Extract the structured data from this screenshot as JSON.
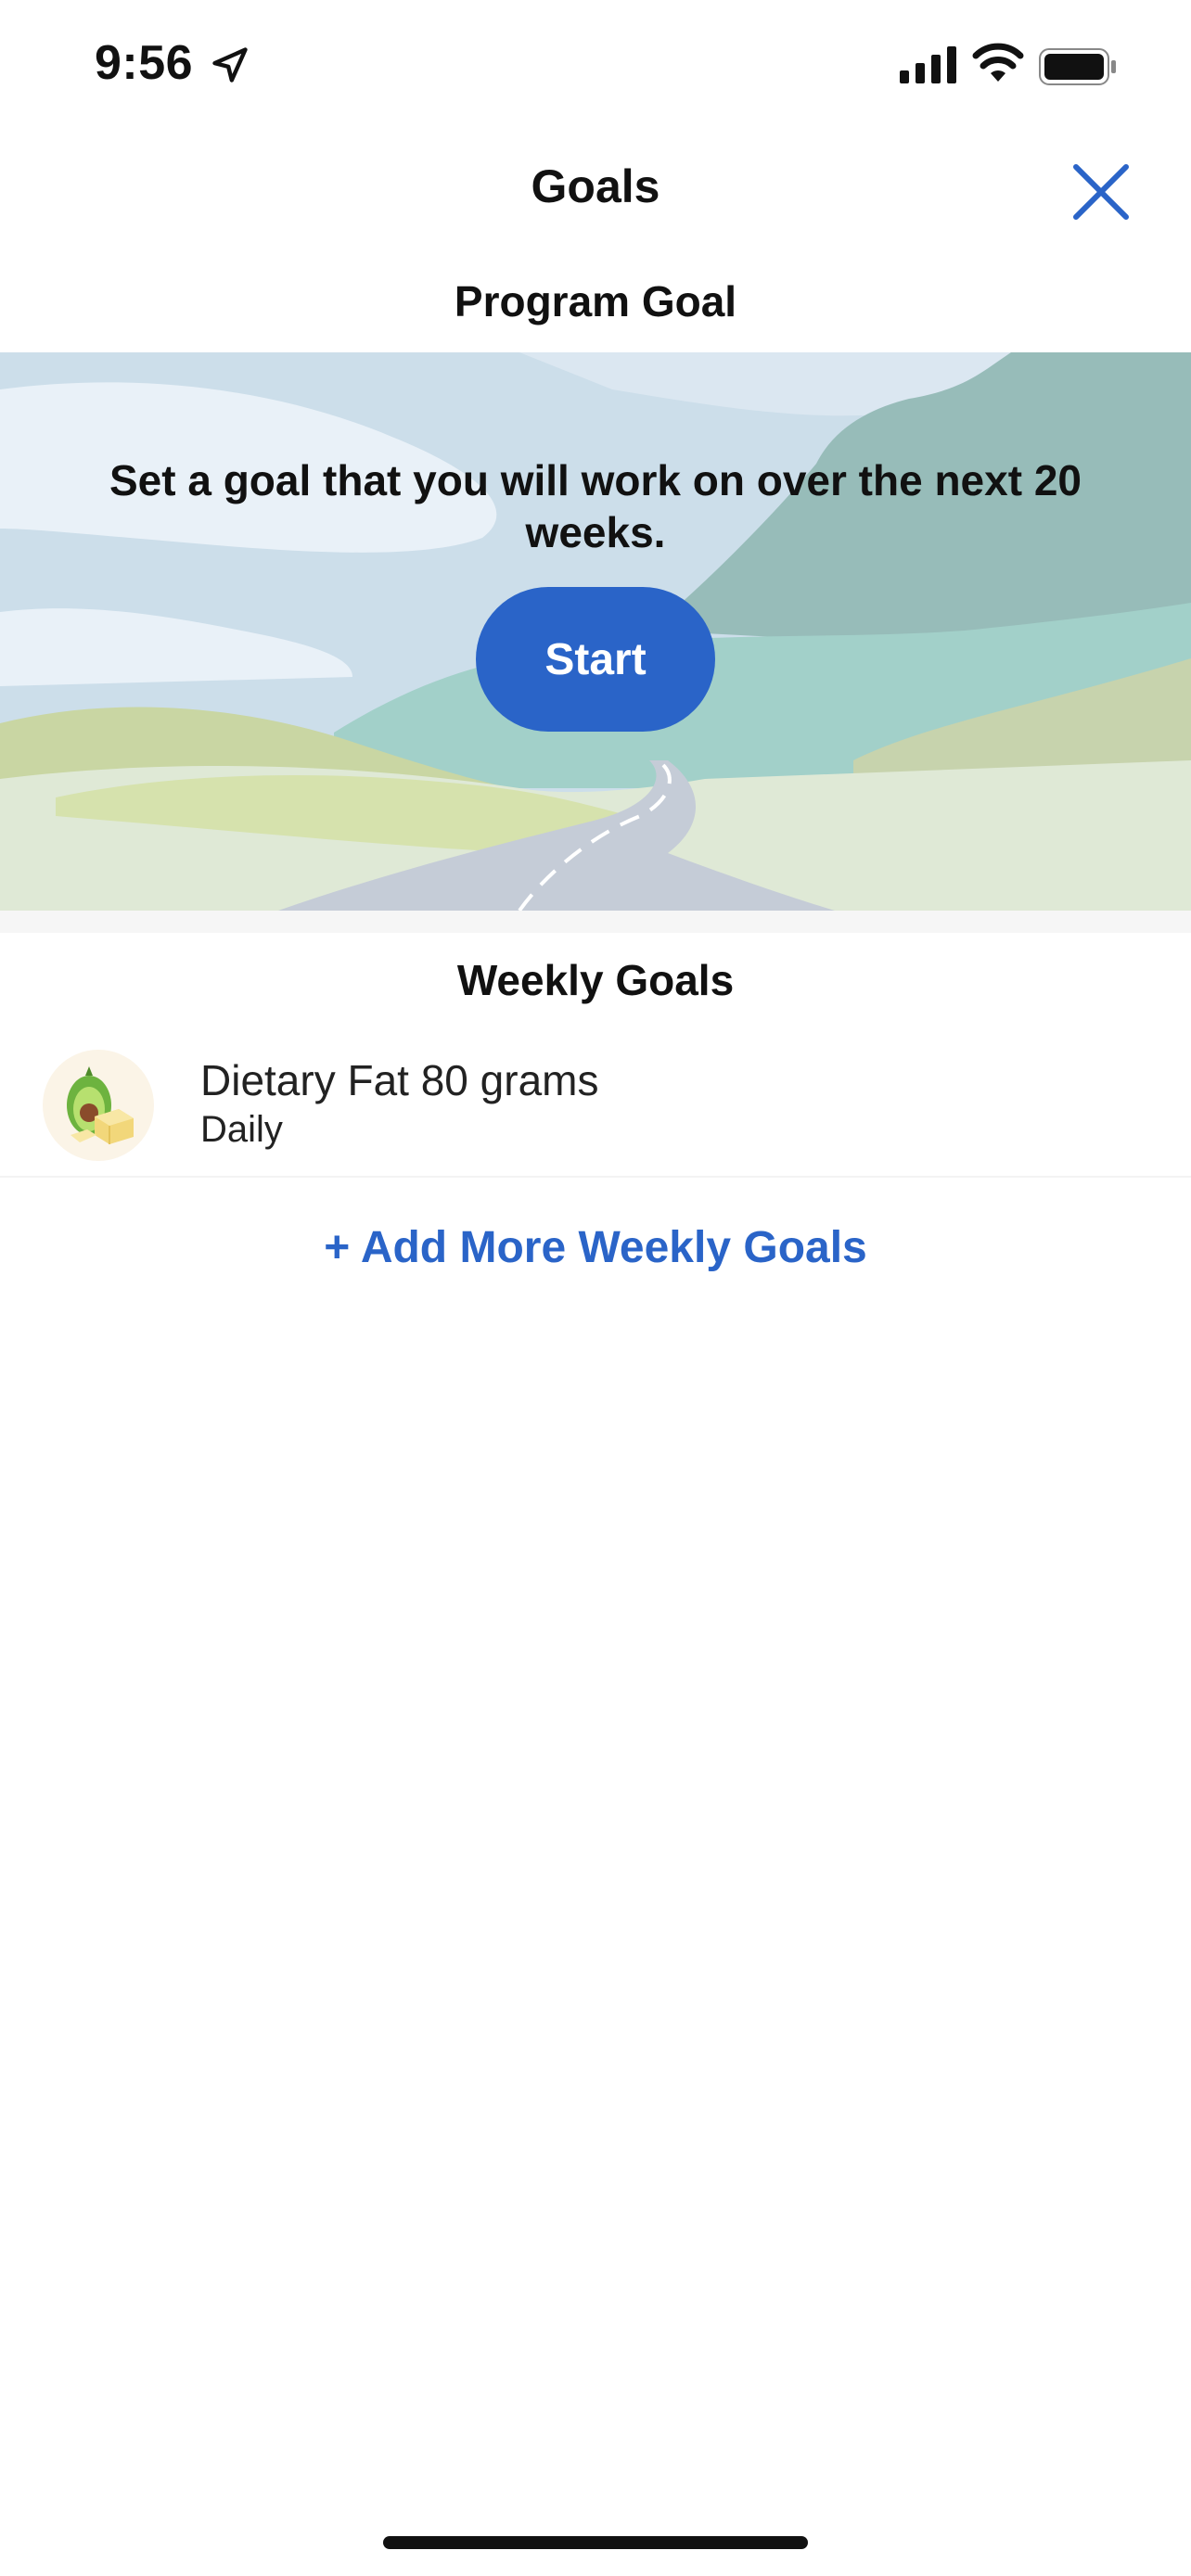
{
  "status": {
    "time": "9:56"
  },
  "nav": {
    "title": "Goals"
  },
  "program_goal": {
    "section_title": "Program Goal",
    "banner_text": "Set a goal that you will work on over the next 20 weeks.",
    "start_label": "Start"
  },
  "weekly_goals": {
    "section_title": "Weekly Goals",
    "items": [
      {
        "name": "Dietary Fat 80 grams",
        "frequency": "Daily",
        "icon": "avocado-butter-icon"
      }
    ],
    "add_label": "+ Add More Weekly Goals"
  },
  "colors": {
    "accent": "#2a64c8"
  }
}
